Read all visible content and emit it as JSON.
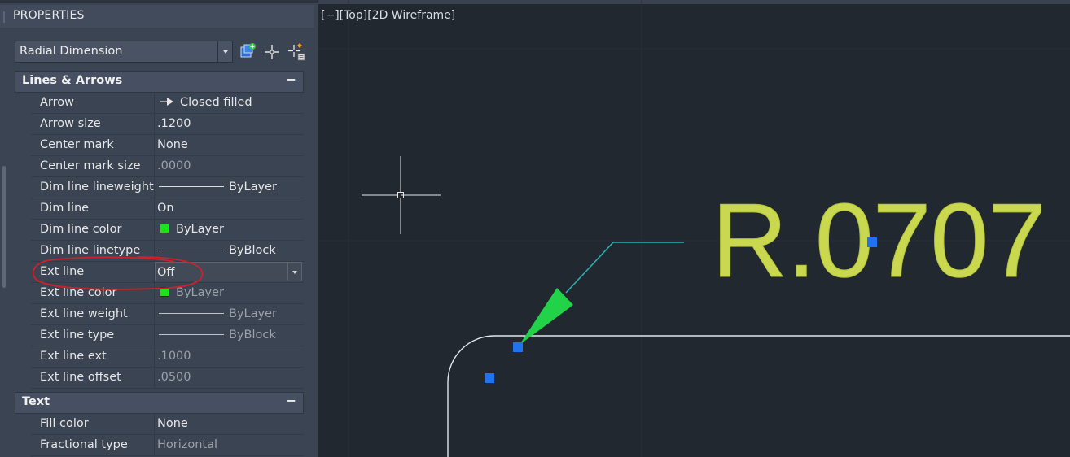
{
  "palette": {
    "title": "PROPERTIES",
    "object_type": "Radial Dimension",
    "tool_icons": [
      "toggle-pickadd-icon",
      "select-objects-icon",
      "quick-select-icon"
    ],
    "sections": [
      {
        "label": "Lines & Arrows",
        "toggle": "−",
        "rows": [
          {
            "name": "Arrow",
            "value": "Closed filled",
            "kind": "arrow"
          },
          {
            "name": "Arrow size",
            "value": ".1200"
          },
          {
            "name": "Center mark",
            "value": "None"
          },
          {
            "name": "Center mark size",
            "value": ".0000",
            "dim": true
          },
          {
            "name": "Dim line lineweight",
            "value": "ByLayer",
            "kind": "line"
          },
          {
            "name": "Dim line",
            "value": "On"
          },
          {
            "name": "Dim line color",
            "value": "ByLayer",
            "kind": "swatch"
          },
          {
            "name": "Dim line linetype",
            "value": "ByBlock",
            "kind": "line"
          },
          {
            "name": "Ext line",
            "value": "Off",
            "kind": "dropdown",
            "selected": true
          },
          {
            "name": "Ext line color",
            "value": "ByLayer",
            "kind": "swatch",
            "dim": true
          },
          {
            "name": "Ext line weight",
            "value": "ByLayer",
            "kind": "line",
            "dim": true
          },
          {
            "name": "Ext line type",
            "value": "ByBlock",
            "kind": "line",
            "dim": true
          },
          {
            "name": "Ext line ext",
            "value": ".1000",
            "dim": true
          },
          {
            "name": "Ext line offset",
            "value": ".0500",
            "dim": true
          }
        ]
      },
      {
        "label": "Text",
        "toggle": "−",
        "rows": [
          {
            "name": "Fill color",
            "value": "None"
          },
          {
            "name": "Fractional type",
            "value": "Horizontal",
            "dim": true
          }
        ]
      }
    ]
  },
  "viewport": {
    "label": "[−][Top][2D Wireframe]",
    "dimension_text": "R.0707"
  },
  "colors": {
    "palette_bg": "#3b4453",
    "viewport_bg": "#212830",
    "dimension_text": "#c9d84f",
    "leader": "#2ab0b0",
    "arrowhead": "#22d34a",
    "grip": "#1e74f0",
    "swatch_green": "#19e619",
    "annotation_red": "#d0202a"
  }
}
